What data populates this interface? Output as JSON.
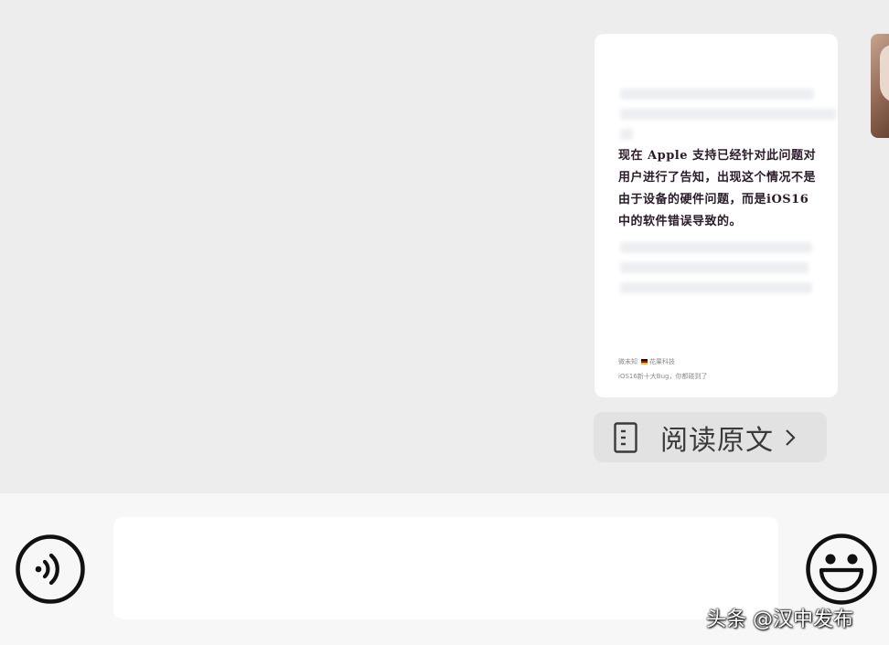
{
  "message_card": {
    "body_text": "现在 Apple 支持已经针对此问题对用户进行了告知，出现这个情况不是由于设备的硬件问题，而是iOS16中的软件错误导致的。",
    "footer_author": "微未知",
    "footer_source": "花果科技",
    "footer_caption": "iOS16新十大Bug，你都碰到了"
  },
  "read_original": {
    "label": "阅读原文",
    "icon": "document-icon",
    "chevron": "chevron-right-icon"
  },
  "input_bar": {
    "voice_icon": "voice-icon",
    "emoji_icon": "smile-icon",
    "input_value": "",
    "input_placeholder": ""
  },
  "watermark": {
    "text": "头条 @汉中发布"
  },
  "colors": {
    "chat_bg": "#ededed",
    "input_bar_bg": "#f7f7f7",
    "card_bg": "#ffffff",
    "link_bg": "#e2e2e2"
  }
}
